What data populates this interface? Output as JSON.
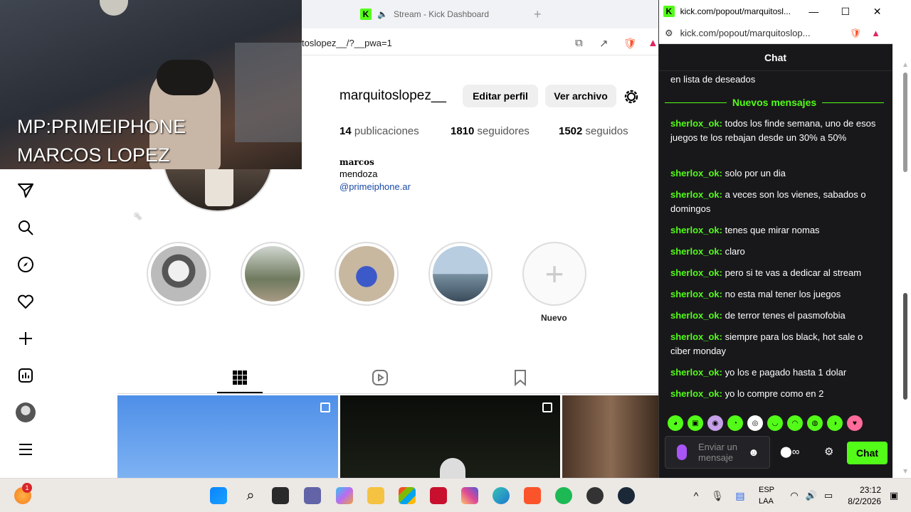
{
  "browser": {
    "tab_title": "Stream - Kick Dashboard",
    "url_fragment": "toslopez__/?__pwa=1"
  },
  "webcam": {
    "line1": "MP:PRIMEIPHONE",
    "line2": "MARCOS LOPEZ"
  },
  "instagram": {
    "username": "marquitoslopez__",
    "edit_profile": "Editar perfil",
    "view_archive": "Ver archivo",
    "stats": [
      {
        "num": "14",
        "label": "publicaciones"
      },
      {
        "num": "1810",
        "label": "seguidores"
      },
      {
        "num": "1502",
        "label": "seguidos"
      }
    ],
    "bio_name": "marcos",
    "bio_location": "mendoza",
    "bio_link": "@primeiphone.ar",
    "new_highlight": "Nuevo",
    "colors": {
      "link": "#1a49a8",
      "button_bg": "#efefef"
    }
  },
  "popout": {
    "title": "kick.com/popout/marquitosl...",
    "url": "kick.com/popout/marquitoslop...",
    "chat_header": "Chat",
    "prev_msg_tail": "en lista de deseados",
    "new_messages": "Nuevos mensajes",
    "messages": [
      {
        "user": "sherlox_ok:",
        "text": "todos los finde semana, uno de esos juegos te los rebajan desde un 30% a 50%"
      },
      {
        "user": "sherlox_ok:",
        "text": "solo por un dia"
      },
      {
        "user": "sherlox_ok:",
        "text": "a veces son los vienes, sabados o domingos"
      },
      {
        "user": "sherlox_ok:",
        "text": "tenes que mirar nomas"
      },
      {
        "user": "sherlox_ok:",
        "text": "claro"
      },
      {
        "user": "sherlox_ok:",
        "text": "pero si te vas a dedicar al stream"
      },
      {
        "user": "sherlox_ok:",
        "text": "no esta mal tener los juegos"
      },
      {
        "user": "sherlox_ok:",
        "text": "de terror tenes el pasmofobia"
      },
      {
        "user": "sherlox_ok:",
        "text": "siempre para los black, hot sale o ciber monday"
      },
      {
        "user": "sherlox_ok:",
        "text": "yo los e pagado hasta 1 dolar"
      },
      {
        "user": "sherlox_ok:",
        "text": "yo lo compre como en 2"
      }
    ],
    "input_placeholder": "Enviar un mensaje",
    "chat_button": "Chat",
    "colors": {
      "accent": "#53fc18",
      "bg": "#18181b"
    }
  },
  "taskbar": {
    "lang1": "ESP",
    "lang2": "LAA",
    "time": "23:12",
    "date": "8/2/2026",
    "badge": "1"
  }
}
